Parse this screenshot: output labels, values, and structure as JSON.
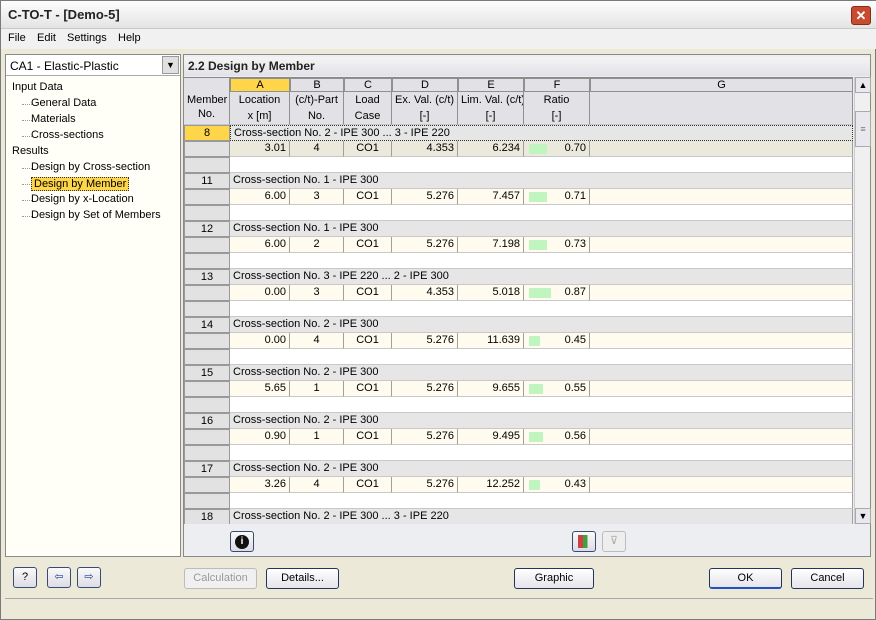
{
  "window": {
    "title": "C-TO-T - [Demo-5]",
    "close": "✕"
  },
  "menu": [
    "File",
    "Edit",
    "Settings",
    "Help"
  ],
  "left": {
    "case_select": "CA1 - Elastic-Plastic",
    "tree": [
      {
        "label": "Input Data",
        "level": 0
      },
      {
        "label": "General Data",
        "level": 1
      },
      {
        "label": "Materials",
        "level": 1
      },
      {
        "label": "Cross-sections",
        "level": 1
      },
      {
        "label": "Results",
        "level": 0
      },
      {
        "label": "Design by Cross-section",
        "level": 1
      },
      {
        "label": "Design by Member",
        "level": 1,
        "selected": true
      },
      {
        "label": "Design by x-Location",
        "level": 1
      },
      {
        "label": "Design by Set of Members",
        "level": 1
      }
    ]
  },
  "panel": {
    "title": "2.2 Design by Member"
  },
  "grid": {
    "col_letters": [
      "A",
      "B",
      "C",
      "D",
      "E",
      "F",
      "G"
    ],
    "header_member": [
      "Member",
      "No."
    ],
    "headers": [
      [
        "Location",
        "x [m]"
      ],
      [
        "(c/t)-Part",
        "No."
      ],
      [
        "Load",
        "Case"
      ],
      [
        "Ex. Val. (c/t)",
        "[-]"
      ],
      [
        "Lim. Val. (c/t)",
        "[-]"
      ],
      [
        "Ratio",
        "[-]"
      ],
      [
        "",
        ""
      ]
    ],
    "members": [
      {
        "no": "8",
        "section": "Cross-section No. 2 - IPE 300 ... 3 - IPE 220",
        "x": "3.01",
        "part": "4",
        "lc": "CO1",
        "ex": "4.353",
        "lim": "6.234",
        "ratio": "0.70"
      },
      {
        "no": "11",
        "section": "Cross-section No.  1 - IPE 300",
        "x": "6.00",
        "part": "3",
        "lc": "CO1",
        "ex": "5.276",
        "lim": "7.457",
        "ratio": "0.71"
      },
      {
        "no": "12",
        "section": "Cross-section No.  1 - IPE 300",
        "x": "6.00",
        "part": "2",
        "lc": "CO1",
        "ex": "5.276",
        "lim": "7.198",
        "ratio": "0.73"
      },
      {
        "no": "13",
        "section": "Cross-section No. 3 - IPE 220 ... 2 - IPE 300",
        "x": "0.00",
        "part": "3",
        "lc": "CO1",
        "ex": "4.353",
        "lim": "5.018",
        "ratio": "0.87"
      },
      {
        "no": "14",
        "section": "Cross-section No.  2 - IPE 300",
        "x": "0.00",
        "part": "4",
        "lc": "CO1",
        "ex": "5.276",
        "lim": "11.639",
        "ratio": "0.45"
      },
      {
        "no": "15",
        "section": "Cross-section No.  2 - IPE 300",
        "x": "5.65",
        "part": "1",
        "lc": "CO1",
        "ex": "5.276",
        "lim": "9.655",
        "ratio": "0.55"
      },
      {
        "no": "16",
        "section": "Cross-section No.  2 - IPE 300",
        "x": "0.90",
        "part": "1",
        "lc": "CO1",
        "ex": "5.276",
        "lim": "9.495",
        "ratio": "0.56"
      },
      {
        "no": "17",
        "section": "Cross-section No.  2 - IPE 300",
        "x": "3.26",
        "part": "4",
        "lc": "CO1",
        "ex": "5.276",
        "lim": "12.252",
        "ratio": "0.43"
      },
      {
        "no": "18",
        "section": "Cross-section No. 2 - IPE 300 ... 3 - IPE 220"
      }
    ],
    "ratio_bar_color": "#c0f5c0",
    "selected_color": "#ffd54a"
  },
  "buttons": {
    "calculation": "Calculation",
    "details": "Details...",
    "graphic": "Graphic",
    "ok": "OK",
    "cancel": "Cancel"
  }
}
